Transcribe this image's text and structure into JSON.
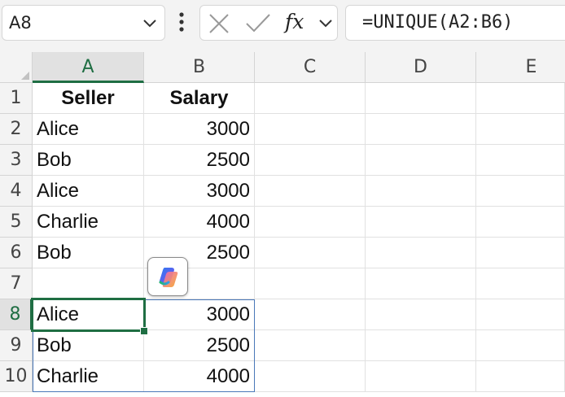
{
  "name_box": {
    "value": "A8"
  },
  "formula_bar": {
    "fx_label": "fx",
    "formula": "=UNIQUE(A2:B6)"
  },
  "columns": [
    "A",
    "B",
    "C",
    "D",
    "E"
  ],
  "rows": [
    "1",
    "2",
    "3",
    "4",
    "5",
    "6",
    "7",
    "8",
    "9",
    "10"
  ],
  "cells": {
    "r1": {
      "a": "Seller",
      "b": "Salary"
    },
    "r2": {
      "a": "Alice",
      "b": "3000"
    },
    "r3": {
      "a": "Bob",
      "b": "2500"
    },
    "r4": {
      "a": "Alice",
      "b": "3000"
    },
    "r5": {
      "a": "Charlie",
      "b": "4000"
    },
    "r6": {
      "a": "Bob",
      "b": "2500"
    },
    "r7": {
      "a": "",
      "b": ""
    },
    "r8": {
      "a": "Alice",
      "b": "3000"
    },
    "r9": {
      "a": "Bob",
      "b": "2500"
    },
    "r10": {
      "a": "Charlie",
      "b": "4000"
    }
  },
  "selection": {
    "active_cell": "A8",
    "selected_column": "A",
    "selected_row": "8"
  },
  "colors": {
    "accent": "#1f6e43",
    "spill_border": "#4a78b8",
    "header_bg": "#f3f3f3"
  },
  "icons": {
    "name_box_dropdown": "chevron-down-icon",
    "more_options": "vertical-dots-icon",
    "cancel": "close-icon",
    "enter": "check-icon",
    "formula_dropdown": "chevron-down-icon",
    "copilot": "copilot-icon"
  }
}
